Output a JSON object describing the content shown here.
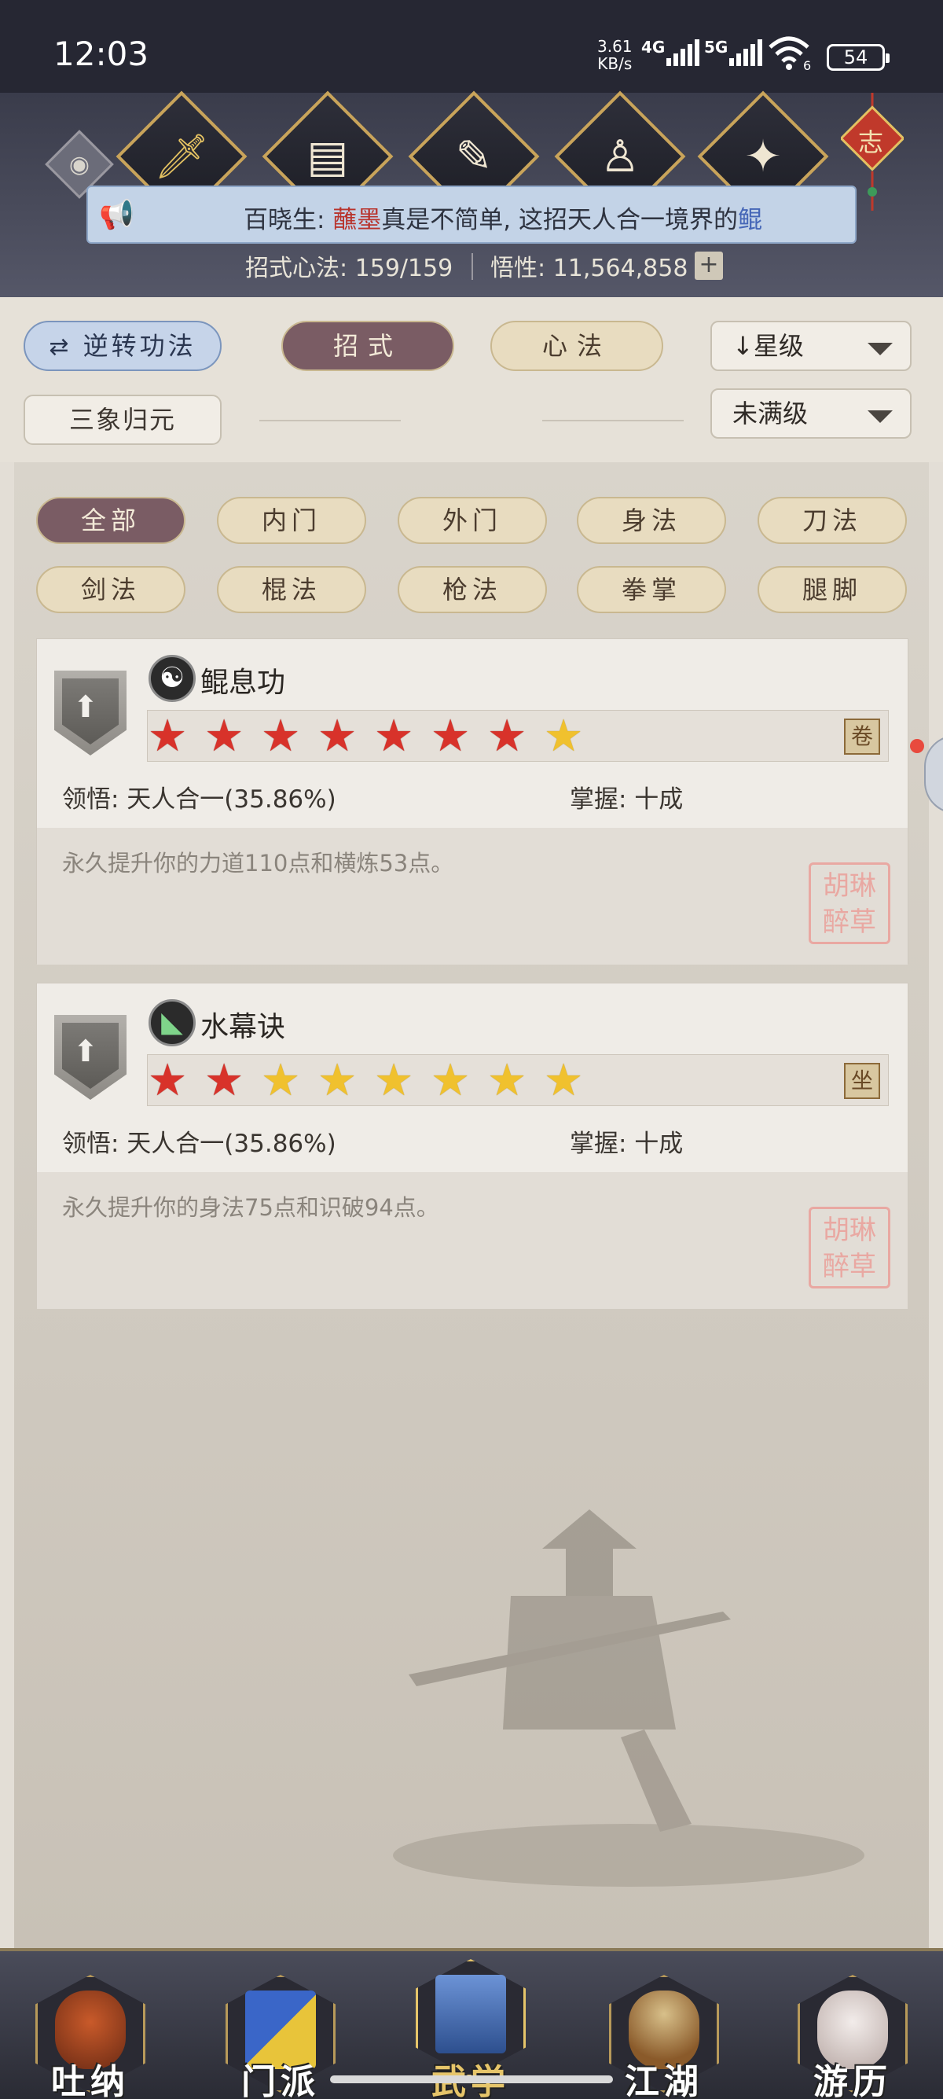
{
  "status_bar": {
    "time": "12:03",
    "net_speed_value": "3.61",
    "net_speed_unit": "KB/s",
    "signal1": "4G",
    "signal2": "5G",
    "wifi_sub": "6",
    "battery": "54"
  },
  "header": {
    "icons": [
      "eye-icon",
      "sword-icon",
      "book-icon",
      "scroll-icon",
      "meditation-icon",
      "martial-pose-icon",
      "knot-charm-icon"
    ],
    "knot_char": "志",
    "announcement": {
      "prefix": "百晓生: ",
      "name": "蘸墨",
      "middle": "真是不简单, 这招天人合一境界的",
      "skill": "鲲"
    },
    "stat_skills_label": "招式心法: 159/159",
    "stat_wuxing_label": "悟性: 11,564,858",
    "plus": "+"
  },
  "filters": {
    "reverse": "逆转功法",
    "tab_moves": "招式",
    "tab_mind": "心法",
    "sort_star": "星级",
    "sanxiang": "三象归元",
    "level_filter": "未满级"
  },
  "categories": [
    "全部",
    "内门",
    "外门",
    "身法",
    "刀法",
    "剑法",
    "棍法",
    "枪法",
    "拳掌",
    "腿脚"
  ],
  "skills": [
    {
      "name": "鲲息功",
      "icon": "yin-yang-icon",
      "stars": [
        "red",
        "red",
        "red",
        "red",
        "red",
        "red",
        "red",
        "gold"
      ],
      "comprehension": "领悟: 天人合一(35.86%)",
      "mastery": "掌握: 十成",
      "description": "永久提升你的力道110点和横炼53点。",
      "seal_text": "胡琳 醉草"
    },
    {
      "name": "水幕诀",
      "icon": "water-boot-icon",
      "stars": [
        "red",
        "red",
        "gold",
        "gold",
        "gold",
        "gold",
        "gold",
        "gold"
      ],
      "comprehension": "领悟: 天人合一(35.86%)",
      "mastery": "掌握: 十成",
      "description": "永久提升你的身法75点和识破94点。",
      "seal_text": "胡琳 醉草"
    }
  ],
  "bottom_nav": [
    {
      "label": "吐纳",
      "icon": "monk-icon",
      "active": false
    },
    {
      "label": "门派",
      "icon": "banner-icon",
      "active": false
    },
    {
      "label": "武学",
      "icon": "manual-book-icon",
      "active": true
    },
    {
      "label": "江湖",
      "icon": "straw-hat-icon",
      "active": false
    },
    {
      "label": "游历",
      "icon": "horse-icon",
      "active": false
    }
  ],
  "colors": {
    "accent_dark_pill": "#7a5c64",
    "star_red": "#d8322a",
    "star_gold": "#f0c12e",
    "announce_name": "#b8332c",
    "announce_skill": "#4566b7"
  }
}
